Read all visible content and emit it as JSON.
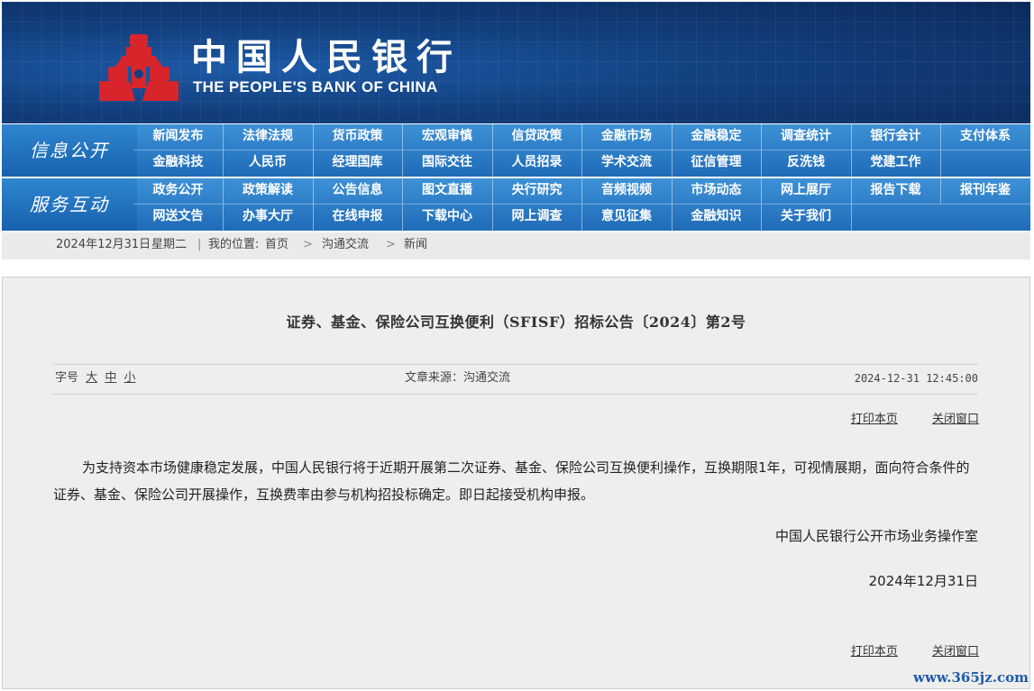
{
  "header": {
    "title_cn": "中国人民银行",
    "title_en": "THE PEOPLE'S BANK OF CHINA",
    "logo_icon": "pboc-emblem-icon",
    "brand_red": "#d7252b"
  },
  "nav": {
    "section1_label": "信息公开",
    "section1_row1": [
      "新闻发布",
      "法律法规",
      "货币政策",
      "宏观审慎",
      "信贷政策",
      "金融市场",
      "金融稳定",
      "调查统计",
      "银行会计",
      "支付体系"
    ],
    "section1_row2": [
      "金融科技",
      "人民币",
      "经理国库",
      "国际交往",
      "人员招录",
      "学术交流",
      "征信管理",
      "反洗钱",
      "党建工作"
    ],
    "section2_label": "服务互动",
    "section2_row1": [
      "政务公开",
      "政策解读",
      "公告信息",
      "图文直播",
      "央行研究",
      "音频视频",
      "市场动态",
      "网上展厅",
      "报告下载",
      "报刊年鉴"
    ],
    "section2_row2": [
      "网送文告",
      "办事大厅",
      "在线申报",
      "下载中心",
      "网上调查",
      "意见征集",
      "金融知识",
      "关于我们"
    ]
  },
  "breadcrumb": {
    "date": "2024年12月31日",
    "weekday": "星期二",
    "separator": "|",
    "location_label": "我的位置:",
    "home": "首页",
    "arrow": ">",
    "level1": "沟通交流",
    "level2": "新闻"
  },
  "article": {
    "title": "证券、基金、保险公司互换便利（SFISF）招标公告〔2024〕第2号",
    "font_size_label": "字号",
    "font_large": "大",
    "font_medium": "中",
    "font_small": "小",
    "source": "文章来源：沟通交流",
    "datetime": "2024-12-31 12:45:00",
    "print_label": "打印本页",
    "close_label": "关闭窗口",
    "body": "为支持资本市场健康稳定发展，中国人民银行将于近期开展第二次证券、基金、保险公司互换便利操作，互换期限1年，可视情展期，面向符合条件的证券、基金、保险公司开展操作，互换费率由参与机构招投标确定。即日起接受机构申报。",
    "signature": "中国人民银行公开市场业务操作室",
    "sign_date": "2024年12月31日"
  },
  "watermark": "www.365jz.com"
}
